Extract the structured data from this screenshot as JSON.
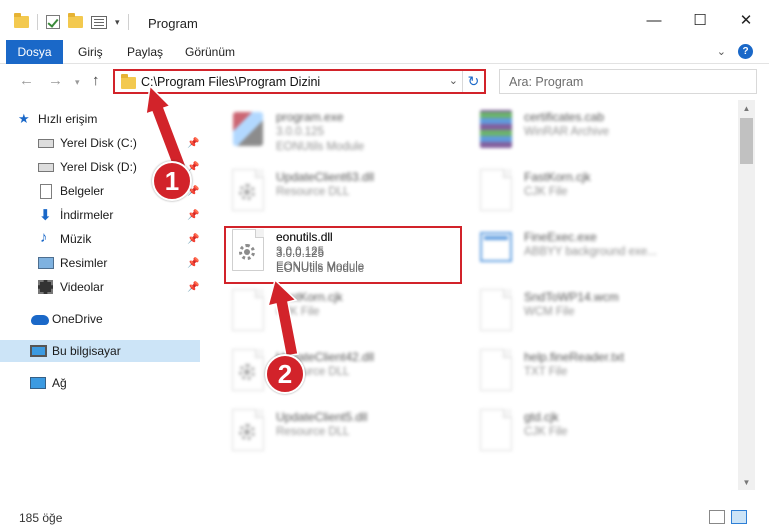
{
  "window": {
    "title": "Program",
    "minimize": "—",
    "maximize": "☐",
    "close": "✕"
  },
  "ribbon": {
    "file_tab": "Dosya",
    "tabs": [
      "Giriş",
      "Paylaş",
      "Görünüm"
    ]
  },
  "address": {
    "path": "C:\\Program Files\\Program Dizini",
    "search_placeholder": "Ara: Program"
  },
  "nav": {
    "quick_access": "Hızlı erişim",
    "items": [
      {
        "label": "Yerel Disk (C:)",
        "icon": "drive-c-icon"
      },
      {
        "label": "Yerel Disk (D:)",
        "icon": "drive-d-icon"
      },
      {
        "label": "Belgeler",
        "icon": "documents-icon"
      },
      {
        "label": "İndirmeler",
        "icon": "downloads-icon"
      },
      {
        "label": "Müzik",
        "icon": "music-icon"
      },
      {
        "label": "Resimler",
        "icon": "pictures-icon"
      },
      {
        "label": "Videolar",
        "icon": "videos-icon"
      }
    ],
    "onedrive": "OneDrive",
    "this_pc": "Bu bilgisayar",
    "network": "Ağ"
  },
  "files": {
    "left": [
      {
        "name": "program.exe",
        "line2": "3.0.0.125",
        "line3": "EONUtils Module"
      },
      {
        "name": "UpdateClient63.dll",
        "line2": "Resource DLL",
        "line3": ""
      },
      {
        "name": "eonutils.dll",
        "line2": "3.0.0.125",
        "line3": "EONUtils Module"
      },
      {
        "name": "FastKorn.cjk",
        "line2": "CJK File",
        "line3": ""
      },
      {
        "name": "UpdateClient42.dll",
        "line2": "Resource DLL",
        "line3": ""
      },
      {
        "name": "UpdateClient5.dll",
        "line2": "Resource DLL",
        "line3": ""
      }
    ],
    "right": [
      {
        "name": "certificates.cab",
        "line2": "WinRAR Archive",
        "line3": ""
      },
      {
        "name": "FastKorn.cjk",
        "line2": "CJK File",
        "line3": ""
      },
      {
        "name": "FineExec.exe",
        "line2": "ABBYY background exe...",
        "line3": ""
      },
      {
        "name": "SndToWP14.wcm",
        "line2": "WCM File",
        "line3": ""
      },
      {
        "name": "help.fineReader.txt",
        "line2": "TXT File",
        "line3": ""
      },
      {
        "name": "gtd.cjk",
        "line2": "CJK File",
        "line3": ""
      }
    ]
  },
  "status": {
    "count": "185 öğe"
  },
  "callouts": [
    "1",
    "2"
  ],
  "colors": {
    "accent": "#1a68c8",
    "highlight": "#d2232a",
    "selection": "#cce4f7"
  }
}
